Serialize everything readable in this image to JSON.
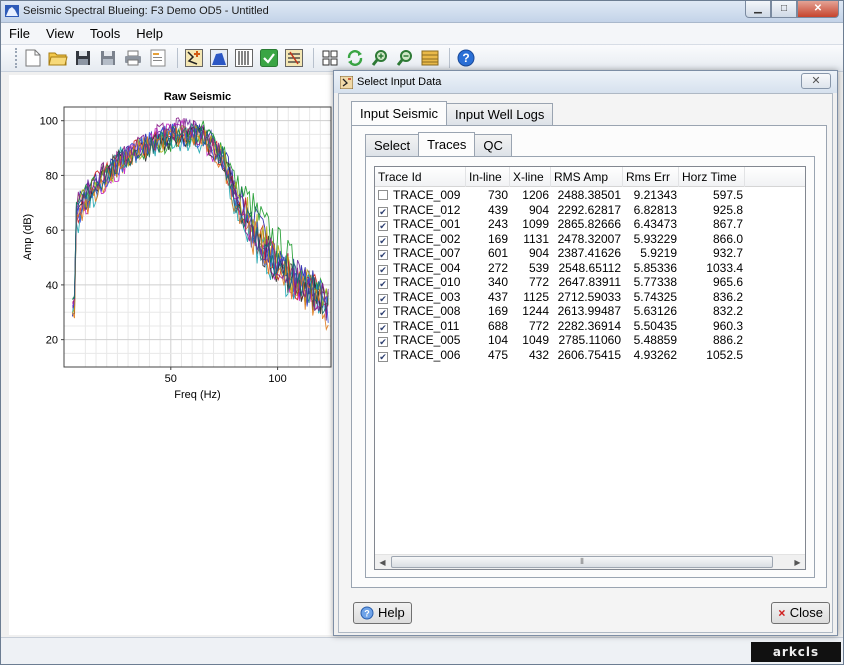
{
  "window": {
    "title": "Seismic Spectral Blueing: F3 Demo OD5 - Untitled"
  },
  "menu": [
    "File",
    "View",
    "Tools",
    "Help"
  ],
  "toolbar": {
    "buttons": [
      "new-file-icon",
      "open-folder-icon",
      "save-icon",
      "save-as-icon",
      "print-icon",
      "report-icon",
      "seismic-input-icon",
      "spectrum-icon",
      "operator-icon",
      "apply-check-icon",
      "filter-icon",
      "grid-layout-icon",
      "refresh-icon",
      "zoom-in-icon",
      "zoom-out-icon",
      "color-bar-icon",
      "help-icon"
    ]
  },
  "chart_data": {
    "type": "line",
    "title": "Raw Seismic",
    "xlabel": "Freq (Hz)",
    "ylabel": "Amp (dB)",
    "xlim": [
      0,
      125
    ],
    "ylim": [
      10,
      105
    ],
    "xticks": [
      50,
      100
    ],
    "yticks": [
      20,
      40,
      60,
      80,
      100
    ],
    "grid": true,
    "series_colors": [
      "#1f1fa8",
      "#d01b1b",
      "#1a9a2a",
      "#c21cc2",
      "#1aa6b0",
      "#6b2a9b",
      "#2a2a2a",
      "#b0b01c",
      "#3355dd",
      "#e07a1a",
      "#8a1c8a",
      "#0f6f6f"
    ],
    "series": [
      {
        "name": "TRACE_009",
        "envelope": [
          [
            5,
            70
          ],
          [
            15,
            78
          ],
          [
            25,
            84
          ],
          [
            35,
            90
          ],
          [
            45,
            94
          ],
          [
            55,
            96
          ],
          [
            65,
            95
          ],
          [
            75,
            88
          ],
          [
            80,
            76
          ],
          [
            90,
            62
          ],
          [
            100,
            50
          ],
          [
            110,
            42
          ],
          [
            120,
            37
          ],
          [
            124,
            33
          ]
        ]
      },
      {
        "name": "TRACE_012",
        "envelope": [
          [
            5,
            65
          ],
          [
            15,
            77
          ],
          [
            25,
            85
          ],
          [
            35,
            89
          ],
          [
            45,
            93
          ],
          [
            55,
            95
          ],
          [
            65,
            94
          ],
          [
            75,
            86
          ],
          [
            80,
            72
          ],
          [
            90,
            58
          ],
          [
            100,
            48
          ],
          [
            110,
            41
          ],
          [
            120,
            36
          ],
          [
            124,
            32
          ]
        ]
      },
      {
        "name": "TRACE_001",
        "envelope": [
          [
            5,
            68
          ],
          [
            15,
            76
          ],
          [
            25,
            83
          ],
          [
            35,
            88
          ],
          [
            45,
            92
          ],
          [
            55,
            94
          ],
          [
            65,
            96
          ],
          [
            75,
            90
          ],
          [
            80,
            78
          ],
          [
            90,
            66
          ],
          [
            100,
            55
          ],
          [
            110,
            45
          ],
          [
            120,
            38
          ],
          [
            124,
            34
          ]
        ]
      },
      {
        "name": "TRACE_002",
        "envelope": [
          [
            5,
            62
          ],
          [
            15,
            75
          ],
          [
            25,
            82
          ],
          [
            35,
            90
          ],
          [
            45,
            95
          ],
          [
            55,
            96
          ],
          [
            65,
            93
          ],
          [
            75,
            85
          ],
          [
            80,
            70
          ],
          [
            90,
            56
          ],
          [
            100,
            46
          ],
          [
            110,
            40
          ],
          [
            120,
            35
          ],
          [
            124,
            31
          ]
        ]
      },
      {
        "name": "TRACE_007",
        "envelope": [
          [
            5,
            60
          ],
          [
            15,
            74
          ],
          [
            25,
            86
          ],
          [
            35,
            89
          ],
          [
            45,
            92
          ],
          [
            55,
            93
          ],
          [
            65,
            92
          ],
          [
            75,
            84
          ],
          [
            80,
            69
          ],
          [
            90,
            55
          ],
          [
            100,
            45
          ],
          [
            110,
            39
          ],
          [
            120,
            34
          ],
          [
            124,
            30
          ]
        ]
      },
      {
        "name": "TRACE_004",
        "envelope": [
          [
            5,
            66
          ],
          [
            15,
            79
          ],
          [
            25,
            84
          ],
          [
            35,
            91
          ],
          [
            45,
            94
          ],
          [
            55,
            97
          ],
          [
            65,
            95
          ],
          [
            75,
            87
          ],
          [
            80,
            73
          ],
          [
            90,
            59
          ],
          [
            100,
            49
          ],
          [
            110,
            42
          ],
          [
            120,
            37
          ],
          [
            124,
            32
          ]
        ]
      },
      {
        "name": "TRACE_010",
        "envelope": [
          [
            5,
            64
          ],
          [
            15,
            78
          ],
          [
            25,
            85
          ],
          [
            35,
            88
          ],
          [
            45,
            93
          ],
          [
            55,
            95
          ],
          [
            65,
            94
          ],
          [
            75,
            86
          ],
          [
            80,
            71
          ],
          [
            90,
            57
          ],
          [
            100,
            47
          ],
          [
            110,
            40
          ],
          [
            120,
            36
          ],
          [
            124,
            33
          ]
        ]
      },
      {
        "name": "TRACE_003",
        "envelope": [
          [
            5,
            67
          ],
          [
            15,
            77
          ],
          [
            25,
            83
          ],
          [
            35,
            90
          ],
          [
            45,
            92
          ],
          [
            55,
            96
          ],
          [
            65,
            94
          ],
          [
            75,
            87
          ],
          [
            80,
            74
          ],
          [
            90,
            60
          ],
          [
            100,
            49
          ],
          [
            110,
            41
          ],
          [
            120,
            36
          ],
          [
            124,
            31
          ]
        ]
      },
      {
        "name": "TRACE_008",
        "envelope": [
          [
            5,
            63
          ],
          [
            15,
            76
          ],
          [
            25,
            84
          ],
          [
            35,
            89
          ],
          [
            45,
            94
          ],
          [
            55,
            95
          ],
          [
            65,
            93
          ],
          [
            75,
            85
          ],
          [
            80,
            70
          ],
          [
            90,
            57
          ],
          [
            100,
            46
          ],
          [
            110,
            40
          ],
          [
            120,
            35
          ],
          [
            124,
            30
          ]
        ]
      },
      {
        "name": "TRACE_011",
        "envelope": [
          [
            5,
            61
          ],
          [
            15,
            75
          ],
          [
            25,
            84
          ],
          [
            35,
            88
          ],
          [
            45,
            93
          ],
          [
            55,
            94
          ],
          [
            65,
            93
          ],
          [
            75,
            84
          ],
          [
            80,
            70
          ],
          [
            90,
            56
          ],
          [
            100,
            46
          ],
          [
            110,
            39
          ],
          [
            120,
            34
          ],
          [
            124,
            29
          ]
        ]
      },
      {
        "name": "TRACE_005",
        "envelope": [
          [
            5,
            69
          ],
          [
            15,
            78
          ],
          [
            25,
            85
          ],
          [
            35,
            90
          ],
          [
            45,
            95
          ],
          [
            55,
            97
          ],
          [
            65,
            95
          ],
          [
            75,
            87
          ],
          [
            80,
            72
          ],
          [
            90,
            58
          ],
          [
            100,
            48
          ],
          [
            110,
            41
          ],
          [
            120,
            36
          ],
          [
            124,
            32
          ]
        ]
      },
      {
        "name": "TRACE_006",
        "envelope": [
          [
            5,
            66
          ],
          [
            15,
            77
          ],
          [
            25,
            84
          ],
          [
            35,
            89
          ],
          [
            45,
            93
          ],
          [
            55,
            95
          ],
          [
            65,
            94
          ],
          [
            75,
            86
          ],
          [
            80,
            71
          ],
          [
            90,
            57
          ],
          [
            100,
            47
          ],
          [
            110,
            40
          ],
          [
            120,
            35
          ],
          [
            124,
            31
          ]
        ]
      }
    ]
  },
  "dialog": {
    "title": "Select Input Data",
    "outer_tabs": [
      "Input Seismic",
      "Input Well Logs"
    ],
    "inner_tabs": [
      "Select",
      "Traces",
      "QC"
    ],
    "columns": [
      "Trace Id",
      "In-line",
      "X-line",
      "RMS Amp",
      "Rms Err",
      "Horz Time"
    ],
    "rows": [
      {
        "checked": false,
        "trace_id": "TRACE_009",
        "inline": "730",
        "xline": "1206",
        "rms_amp": "2488.38501",
        "rms_err": "9.21343",
        "horz_time": "597.5"
      },
      {
        "checked": true,
        "trace_id": "TRACE_012",
        "inline": "439",
        "xline": "904",
        "rms_amp": "2292.62817",
        "rms_err": "6.82813",
        "horz_time": "925.8"
      },
      {
        "checked": true,
        "trace_id": "TRACE_001",
        "inline": "243",
        "xline": "1099",
        "rms_amp": "2865.82666",
        "rms_err": "6.43473",
        "horz_time": "867.7"
      },
      {
        "checked": true,
        "trace_id": "TRACE_002",
        "inline": "169",
        "xline": "1131",
        "rms_amp": "2478.32007",
        "rms_err": "5.93229",
        "horz_time": "866.0"
      },
      {
        "checked": true,
        "trace_id": "TRACE_007",
        "inline": "601",
        "xline": "904",
        "rms_amp": "2387.41626",
        "rms_err": "5.9219",
        "horz_time": "932.7"
      },
      {
        "checked": true,
        "trace_id": "TRACE_004",
        "inline": "272",
        "xline": "539",
        "rms_amp": "2548.65112",
        "rms_err": "5.85336",
        "horz_time": "1033.4"
      },
      {
        "checked": true,
        "trace_id": "TRACE_010",
        "inline": "340",
        "xline": "772",
        "rms_amp": "2647.83911",
        "rms_err": "5.77338",
        "horz_time": "965.6"
      },
      {
        "checked": true,
        "trace_id": "TRACE_003",
        "inline": "437",
        "xline": "1125",
        "rms_amp": "2712.59033",
        "rms_err": "5.74325",
        "horz_time": "836.2"
      },
      {
        "checked": true,
        "trace_id": "TRACE_008",
        "inline": "169",
        "xline": "1244",
        "rms_amp": "2613.99487",
        "rms_err": "5.63126",
        "horz_time": "832.2"
      },
      {
        "checked": true,
        "trace_id": "TRACE_011",
        "inline": "688",
        "xline": "772",
        "rms_amp": "2282.36914",
        "rms_err": "5.50435",
        "horz_time": "960.3"
      },
      {
        "checked": true,
        "trace_id": "TRACE_005",
        "inline": "104",
        "xline": "1049",
        "rms_amp": "2785.11060",
        "rms_err": "5.48859",
        "horz_time": "886.2"
      },
      {
        "checked": true,
        "trace_id": "TRACE_006",
        "inline": "475",
        "xline": "432",
        "rms_amp": "2606.75415",
        "rms_err": "4.93262",
        "horz_time": "1052.5"
      }
    ],
    "help_label": "Help",
    "close_label": "Close"
  },
  "brand": "arkcls"
}
